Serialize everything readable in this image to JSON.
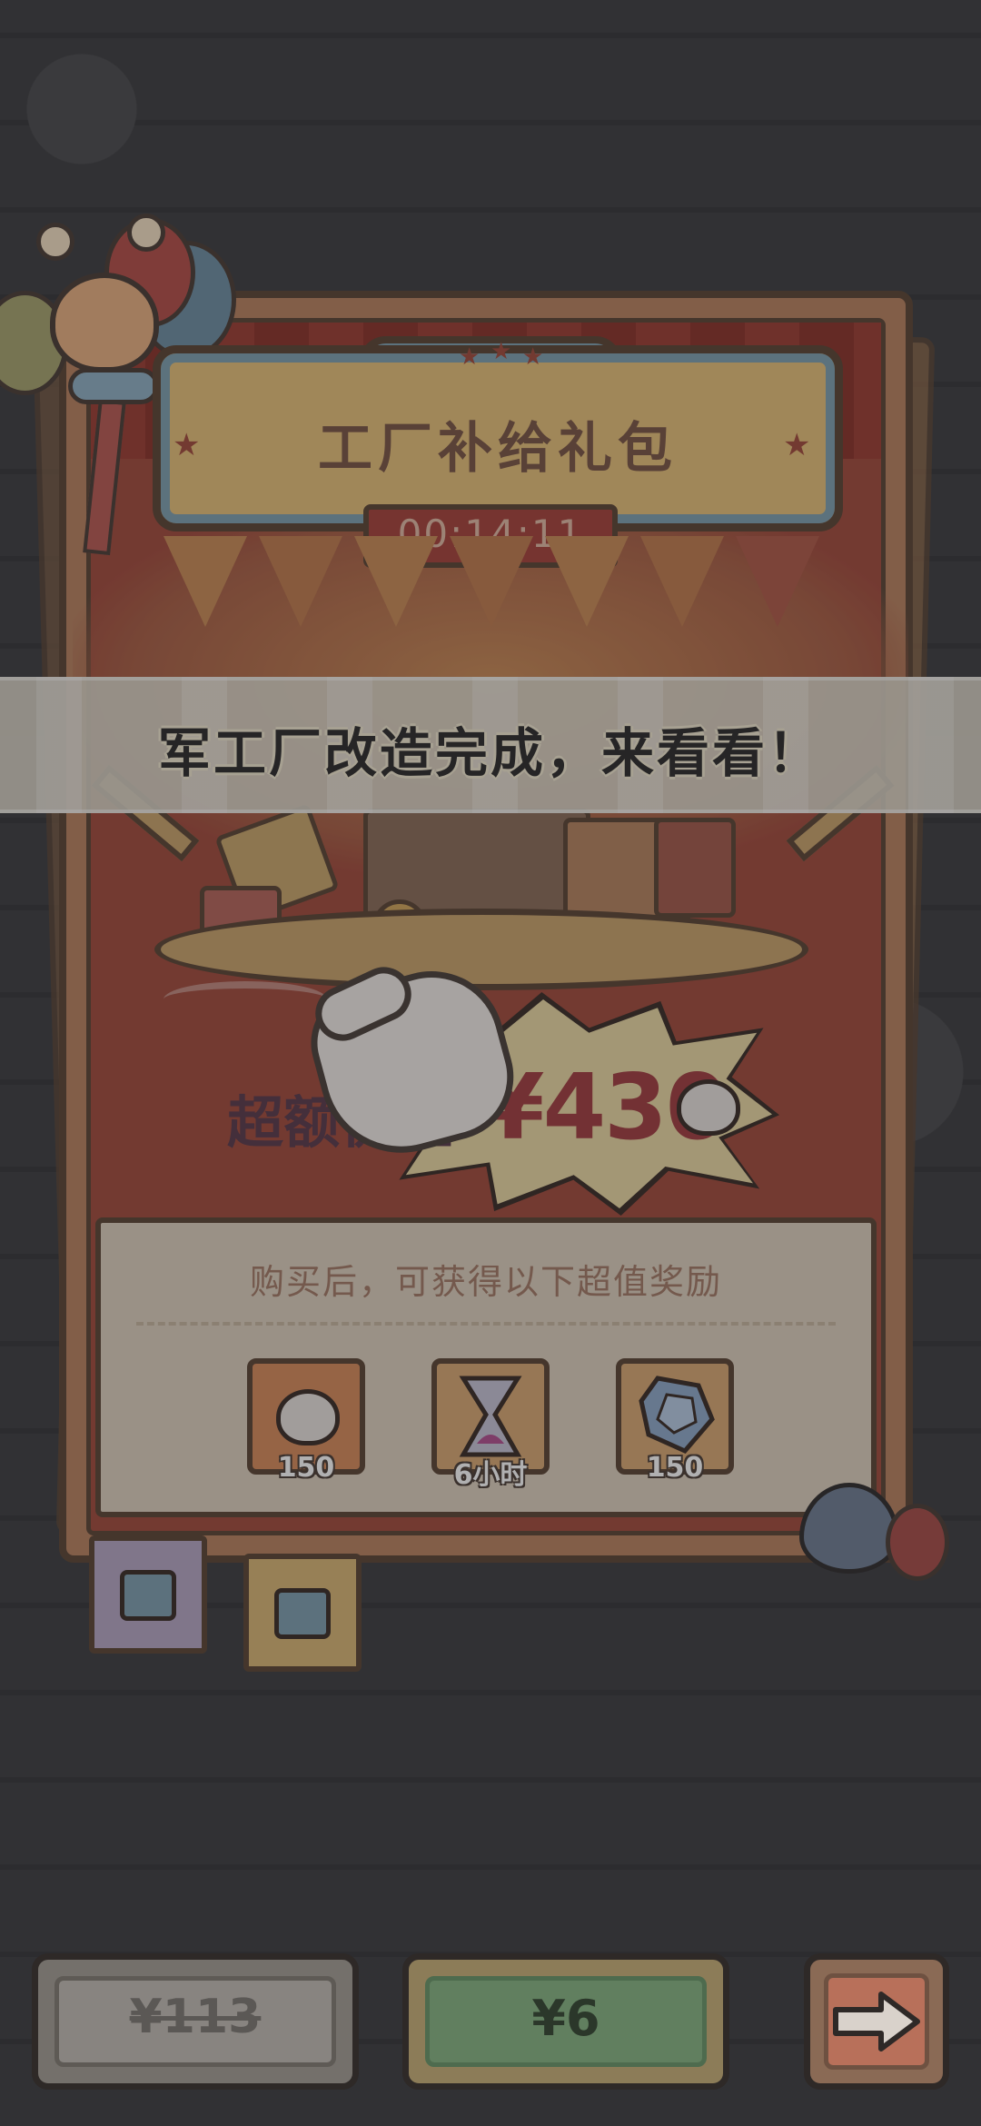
{
  "pack": {
    "title": "工厂补给礼包",
    "timer": "00:14:11"
  },
  "banner": {
    "text": "军工厂改造完成，来看看！"
  },
  "value": {
    "label": "超额价值",
    "amount": "¥430"
  },
  "rewards": {
    "heading": "购买后，可获得以下超值奖励",
    "items": [
      {
        "icon": "ghost-icon",
        "count": "150",
        "color": "#d88a5a"
      },
      {
        "icon": "hourglass-icon",
        "count": "6小时",
        "color": "#d9a872"
      },
      {
        "icon": "crystal-icon",
        "count": "150",
        "color": "#d9a872"
      }
    ]
  },
  "tabs": [
    {
      "icon": "gift-icon",
      "color": "#b5a6c4"
    },
    {
      "icon": "gift-icon",
      "color": "#d9b574"
    }
  ],
  "buttons": {
    "original_price": "¥113",
    "buy_price": "¥6",
    "next_icon": "arrow-right-icon"
  }
}
